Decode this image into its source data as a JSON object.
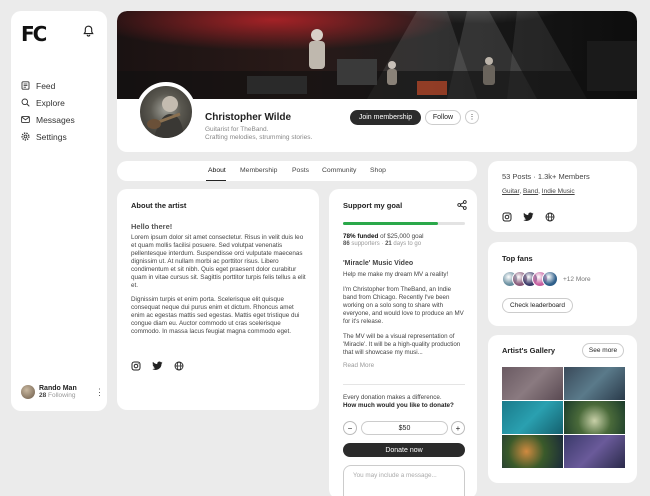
{
  "sidebar": {
    "logo": "FC",
    "items": [
      {
        "label": "Feed",
        "icon": "feed-icon"
      },
      {
        "label": "Explore",
        "icon": "search-icon"
      },
      {
        "label": "Messages",
        "icon": "mail-icon"
      },
      {
        "label": "Settings",
        "icon": "gear-icon"
      }
    ],
    "user": {
      "name": "Rando Man",
      "following_count": "28",
      "following_label": "Following"
    }
  },
  "profile": {
    "name": "Christopher Wilde",
    "bio_line1": "Guitarist for TheBand.",
    "bio_line2": "Crafting melodies, strumming stories.",
    "join_label": "Join membership",
    "follow_label": "Follow",
    "more_label": "⋮"
  },
  "tabs": [
    "About",
    "Membership",
    "Posts",
    "Community",
    "Shop"
  ],
  "active_tab": "About",
  "about": {
    "title": "About the artist",
    "hello": "Hello there!",
    "para1": "Lorem ipsum dolor sit amet consectetur. Risus in velit duis leo et quam mollis facilisi posuere. Sed volutpat venenatis pellentesque interdum. Suspendisse orci vulputate maecenas dignissim ut. At nullam morbi ac porttitor risus. Libero condimentum et sit nibh. Quis eget praesent dolor curabitur quam in vitae cursus sit. Sagittis porttitor turpis felis tellus a elit et.",
    "para2": "Dignissim turpis et enim porta. Scelerisque elit quisque consequat neque dui purus enim et dictum. Rhoncus amet enim ac egestas mattis sed egestas. Mattis eget tristique dui congue diam eu. Auctor commodo ut cras scelerisque commodo. In massa lacus feugiat magna commodo eget."
  },
  "support": {
    "title": "Support my goal",
    "progress": 0.78,
    "funded_pct": "78% funded",
    "funded_rest": "of $25,000 goal",
    "supporters_count": "86",
    "supporters_label": "supporters",
    "days_count": "21",
    "days_label": "days to go",
    "subtitle": "'Miracle' Music Video",
    "p1": "Help me make my dream MV a reality!",
    "p2": "I'm Christopher from TheBand, an Indie band from Chicago. Recently I've been working on a solo song to share with everyone, and would love to produce an MV for it's release.",
    "p3": "The MV will be a visual representation of 'Miracle'. It will be a high-quality production that will showcase my musi...",
    "read_more": "Read More",
    "donation_line1": "Every donation makes a difference.",
    "donation_line2": "How much would you like to donate?",
    "minus": "−",
    "amount": "$50",
    "plus": "+",
    "donate_label": "Donate now",
    "message_placeholder": "You may include a message..."
  },
  "stats": {
    "posts": "53 Posts",
    "sep": "·",
    "members": "1.3k+ Members",
    "tags": [
      "Guitar",
      "Band",
      "Indie Music"
    ]
  },
  "fans": {
    "title": "Top fans",
    "more": "+12 More",
    "button": "Check leaderboard",
    "avatar_colors": [
      "#6a8fa0",
      "#8a5a7a",
      "#3b3b6a",
      "#c85fa0",
      "#2f5f8a"
    ]
  },
  "gallery": {
    "title": "Artist's Gallery",
    "button": "See more"
  }
}
